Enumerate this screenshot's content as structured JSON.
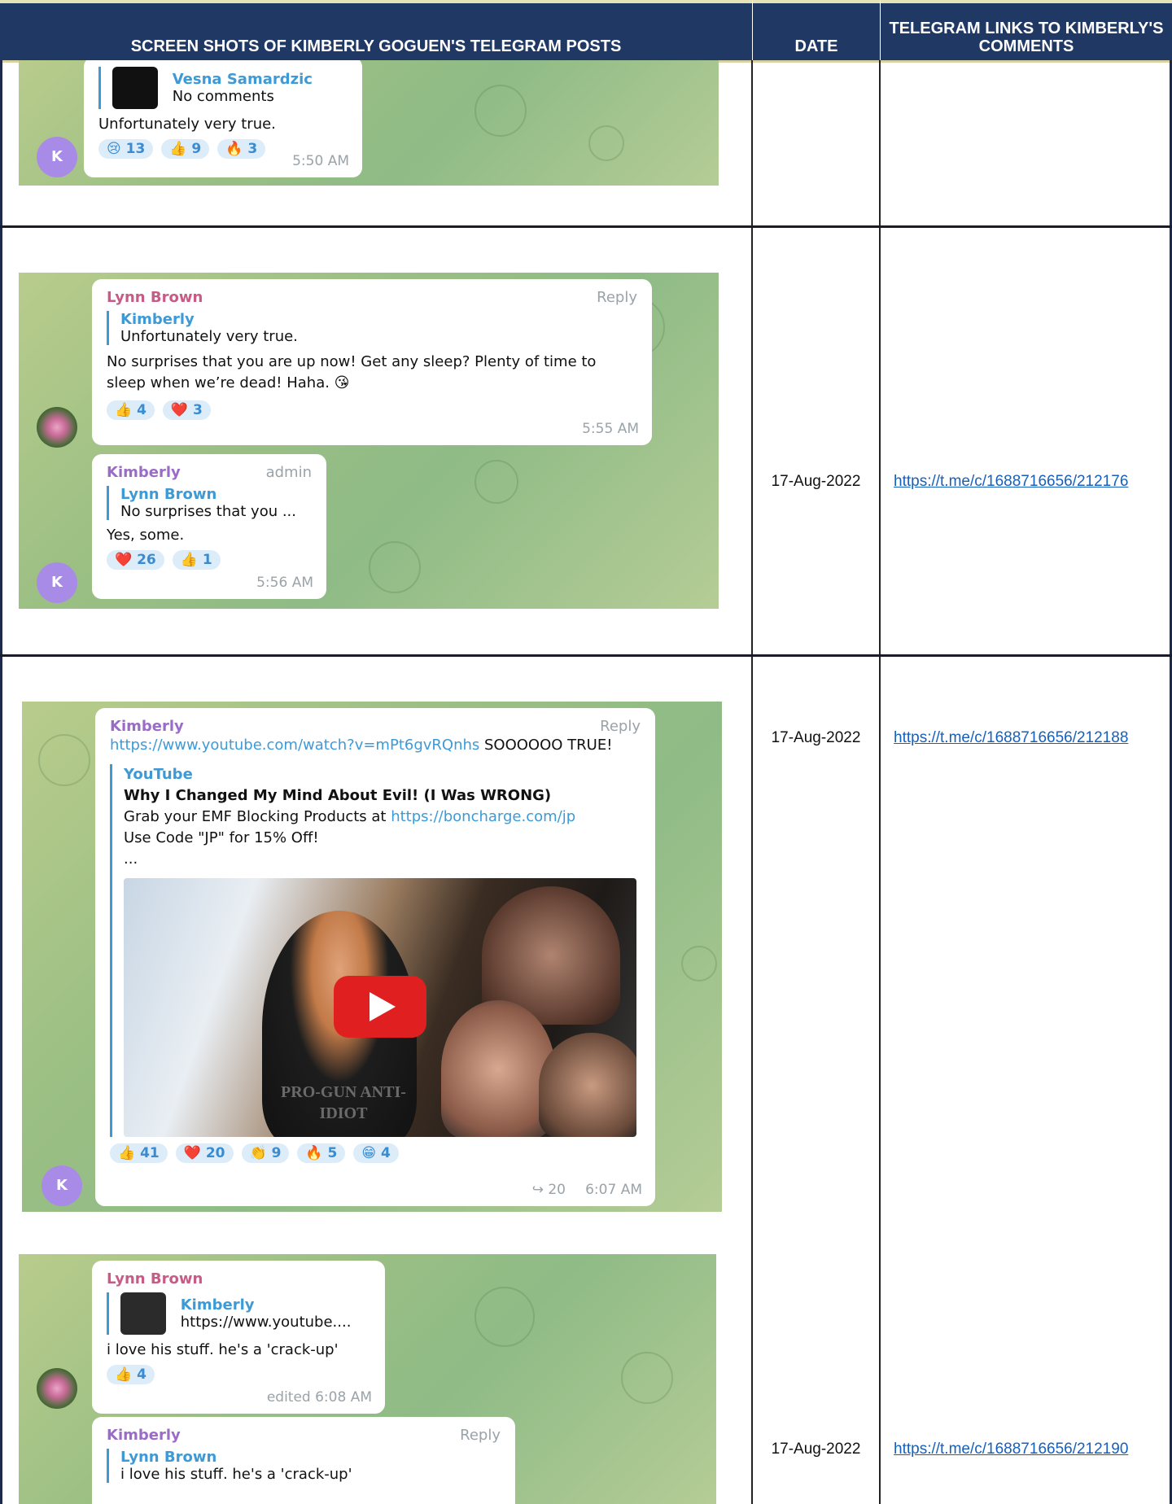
{
  "header": {
    "col1": "SCREEN SHOTS OF KIMBERLY GOGUEN'S TELEGRAM POSTS",
    "col2": "DATE",
    "col3": "TELEGRAM LINKS TO KIMBERLY'S COMMENTS"
  },
  "rows": [
    {
      "date": "",
      "link": ""
    },
    {
      "date": "17-Aug-2022",
      "link": "https://t.me/c/1688716656/212176"
    },
    {
      "date": "17-Aug-2022",
      "link": "https://t.me/c/1688716656/212188"
    },
    {
      "date": "17-Aug-2022",
      "link": "https://t.me/c/1688716656/212190"
    }
  ],
  "shots": {
    "s1": {
      "quote_name": "Vesna Samardzic",
      "quote_text": "No comments",
      "text": "Unfortunately very true.",
      "reactions": [
        "😢 13",
        "👍 9",
        "🔥 3"
      ],
      "time": "5:50 AM",
      "avatar": "K"
    },
    "s2a": {
      "name": "Lynn Brown",
      "reply": "Reply",
      "quote_name": "Kimberly",
      "quote_text": "Unfortunately very true.",
      "text": "No surprises that you are up now! Get any sleep? Plenty of time to sleep when we’re dead! Haha. 😘",
      "reactions": [
        "👍 4",
        "❤️ 3"
      ],
      "time": "5:55 AM"
    },
    "s2b": {
      "name": "Kimberly",
      "role": "admin",
      "quote_name": "Lynn Brown",
      "quote_text": "No surprises that you ...",
      "text": "Yes, some.",
      "reactions": [
        "❤️ 26",
        "👍 1"
      ],
      "time": "5:56 AM",
      "avatar": "K"
    },
    "s3": {
      "name": "Kimberly",
      "reply": "Reply",
      "url": "https://www.youtube.com/watch?v=mPt6gvRQnhs",
      "tail": " SOOOOOO TRUE!",
      "site": "YouTube",
      "title": "Why I Changed My Mind About Evil! (I Was WRONG)",
      "desc_pre": "Grab your EMF Blocking Products at ",
      "desc_link": "https://boncharge.com/jp",
      "desc2": "Use Code \"JP\" for 15% Off!",
      "desc3": "...",
      "shirt": "PRO-GUN ANTI-IDIOT",
      "reactions": [
        "👍 41",
        "❤️ 20",
        "👏 9",
        "🔥 5",
        "😁 4"
      ],
      "forwards": "↪ 20",
      "time": "6:07 AM",
      "avatar": "K"
    },
    "s4a": {
      "name": "Lynn Brown",
      "quote_name": "Kimberly",
      "quote_text": "https://www.youtube....",
      "text": "i love his stuff. he's a 'crack-up'",
      "reactions": [
        "👍 4"
      ],
      "time": "edited 6:08 AM"
    },
    "s4b": {
      "name": "Kimberly",
      "reply": "Reply",
      "quote_name": "Lynn Brown",
      "quote_text": "i love his stuff. he's a 'crack-up'"
    }
  }
}
